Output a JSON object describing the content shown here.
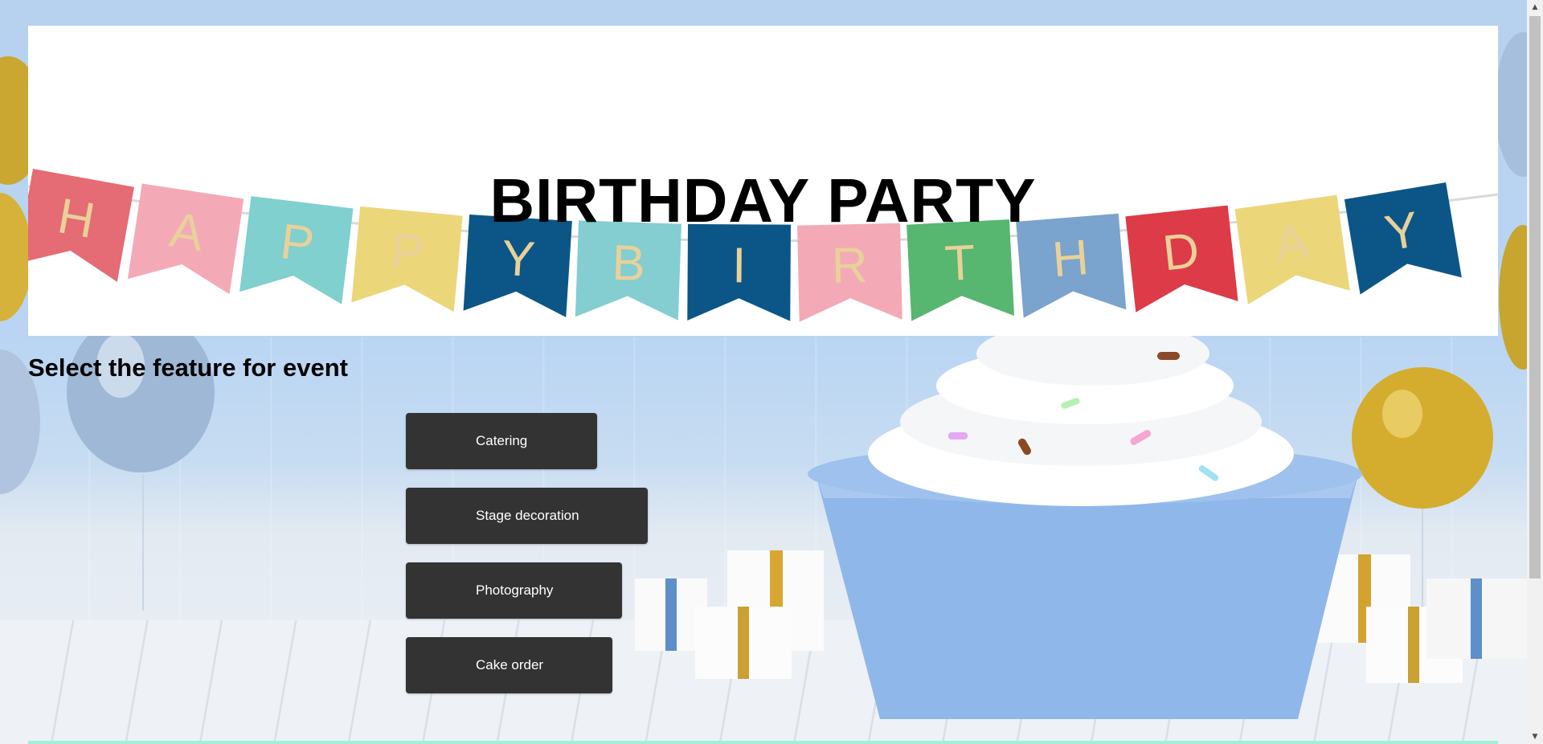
{
  "banner": {
    "title": "BIRTHDAY PARTY",
    "pennant_letters": [
      "H",
      "A",
      "P",
      "P",
      "Y",
      "B",
      "I",
      "R",
      "T",
      "H",
      "D",
      "A",
      "Y"
    ],
    "pennant_colors": [
      "#e56b74",
      "#f3aab6",
      "#7fd0cf",
      "#ecd67a",
      "#0b5687",
      "#84cdd0",
      "#0b5687",
      "#f3aab6",
      "#57b66f",
      "#7aa3cd",
      "#dd3b47",
      "#ecd67a",
      "#0b5687"
    ]
  },
  "section": {
    "heading": "Select the feature for event"
  },
  "features": [
    {
      "label": "Catering"
    },
    {
      "label": "Stage decoration"
    },
    {
      "label": "Photography"
    },
    {
      "label": "Cake order"
    }
  ],
  "colors": {
    "button_bg": "#333333",
    "button_text": "#ffffff",
    "accent_strip": "#9ff0d6"
  },
  "scrollbar": {
    "up_icon": "triangle-up",
    "down_icon": "triangle-down"
  }
}
